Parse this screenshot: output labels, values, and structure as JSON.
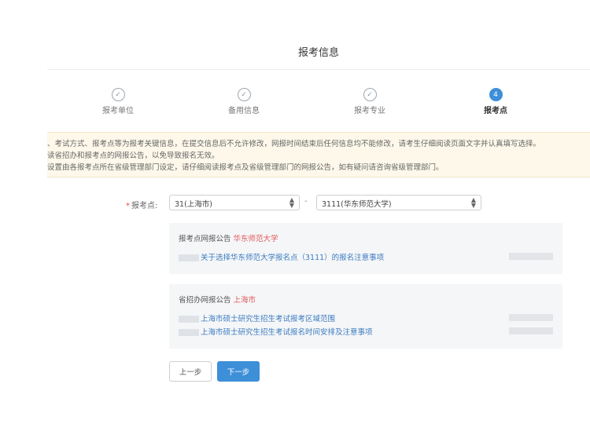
{
  "page_title": "报考信息",
  "steps": [
    {
      "label": "报考单位",
      "marker": "✓",
      "active": false
    },
    {
      "label": "备用信息",
      "marker": "✓",
      "active": false
    },
    {
      "label": "报考专业",
      "marker": "✓",
      "active": false
    },
    {
      "label": "报考点",
      "marker": "4",
      "active": true
    }
  ],
  "notice": {
    "lines": [
      "、考试方式、报考点等为报考关键信息，在提交信息后不允许修改，网报时间结束后任何信息均不能修改，请考生仔细阅读页面文字并认真填写选择。",
      "读省招办和报考点的网报公告，以免导致报名无效。",
      "设置由各报考点所在省级管理部门设定，请仔细阅读报考点及省级管理部门的网报公告，如有疑问请咨询省级管理部门。"
    ]
  },
  "form": {
    "required_mark": "*",
    "label": "报考点:",
    "province_value": "31(上海市)",
    "site_value": "3111(华东师范大学)",
    "separator": "-"
  },
  "site_notice": {
    "title_prefix": "报考点网报公告",
    "title_highlight": "华东师范大学",
    "items": [
      "关于选择华东师范大学报名点（3111）的报名注意事项"
    ]
  },
  "province_notice": {
    "title_prefix": "省招办网报公告",
    "title_highlight": "上海市",
    "items": [
      "上海市硕士研究生招生考试报考区域范围",
      "上海市硕士研究生招生考试报名时间安排及注意事项"
    ]
  },
  "buttons": {
    "prev": "上一步",
    "next": "下一步"
  },
  "colors": {
    "primary": "#3d8fd8",
    "highlight": "#e05a5a",
    "link": "#3a7bbf",
    "notice_bg": "#fdf8ea"
  }
}
